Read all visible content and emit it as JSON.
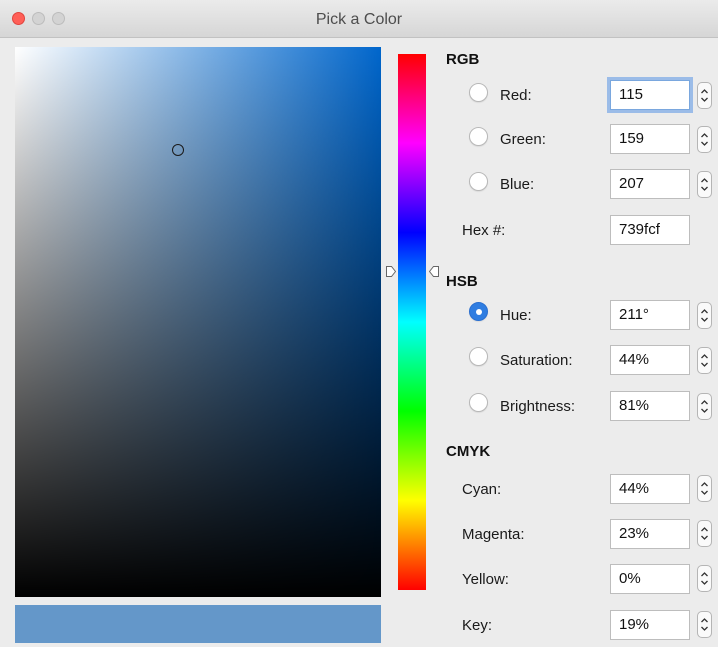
{
  "window": {
    "title": "Pick a Color"
  },
  "color": {
    "swatch_hex": "#6497c9",
    "gradient_hue_hex": "#0066cc"
  },
  "rgb": {
    "heading": "RGB",
    "red": {
      "label": "Red:",
      "value": "115"
    },
    "green": {
      "label": "Green:",
      "value": "159"
    },
    "blue": {
      "label": "Blue:",
      "value": "207"
    },
    "hex": {
      "label": "Hex #:",
      "value": "739fcf"
    }
  },
  "hsb": {
    "heading": "HSB",
    "hue": {
      "label": "Hue:",
      "value": "211°"
    },
    "saturation": {
      "label": "Saturation:",
      "value": "44%"
    },
    "brightness": {
      "label": "Brightness:",
      "value": "81%"
    }
  },
  "cmyk": {
    "heading": "CMYK",
    "cyan": {
      "label": "Cyan:",
      "value": "44%"
    },
    "magenta": {
      "label": "Magenta:",
      "value": "23%"
    },
    "yellow": {
      "label": "Yellow:",
      "value": "0%"
    },
    "key": {
      "label": "Key:",
      "value": "19%"
    }
  },
  "selected_channel": "hue",
  "icons": {
    "stepper": "up-down-chevrons-icon",
    "hue_marker": "triangle-pointer-icon",
    "picker": "circle-cursor-icon"
  }
}
